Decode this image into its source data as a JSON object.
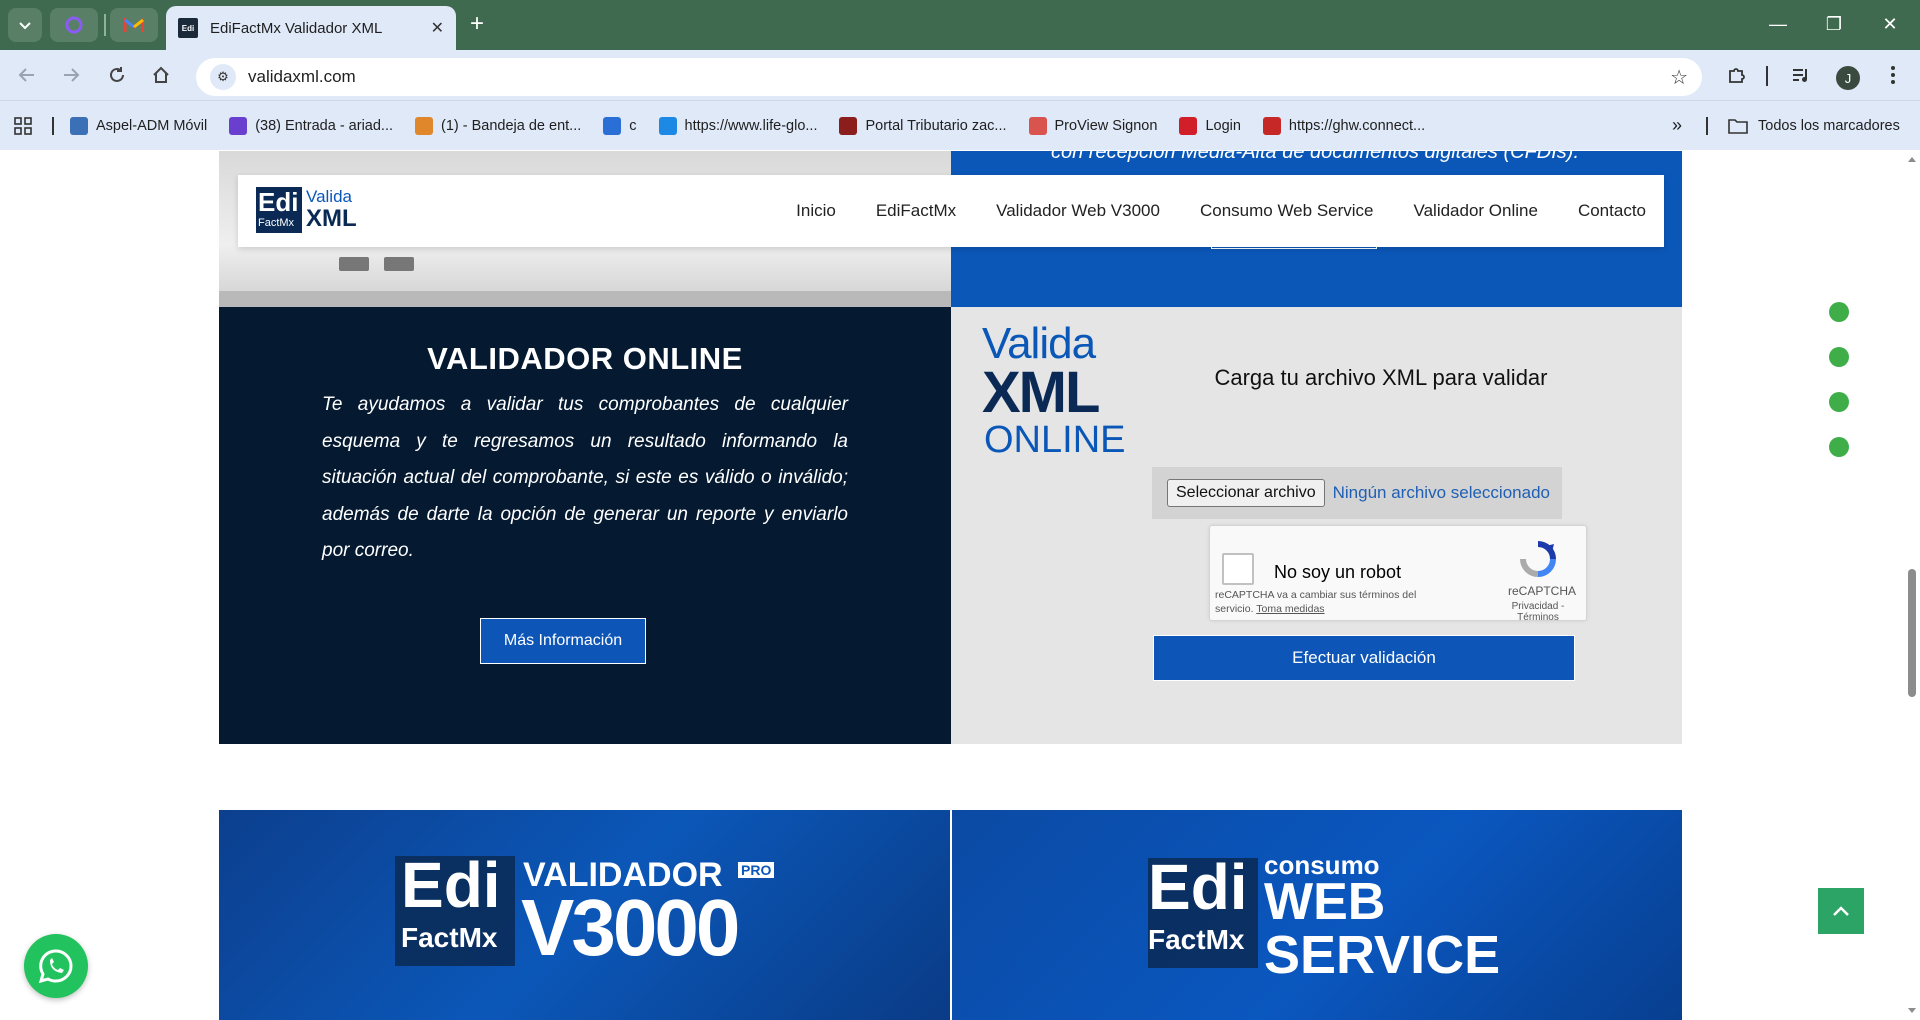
{
  "browser": {
    "pinned_tabs": [
      "tab-1",
      "tab-2",
      "tab-3"
    ],
    "active_tab": {
      "favicon_text": "EdiFactMx",
      "title": "EdiFactMx Validador XML",
      "close": "✕"
    },
    "new_tab": "+",
    "window_controls": {
      "minimize": "—",
      "restore": "❐",
      "close": "✕"
    },
    "url": "validaxml.com",
    "profile_initial": "J",
    "bookmarks": [
      {
        "label": "Aspel-ADM Móvil",
        "icon_color": "#3b6fb6"
      },
      {
        "label": "(38) Entrada - ariad...",
        "icon_color": "#6a3fd0"
      },
      {
        "label": "(1) - Bandeja de ent...",
        "icon_color": "#e0862b"
      },
      {
        "label": "c",
        "icon_color": "#2a6fd6"
      },
      {
        "label": "https://www.life-glo...",
        "icon_color": "#1e88e5"
      },
      {
        "label": "Portal Tributario zac...",
        "icon_color": "#8b1d1d"
      },
      {
        "label": "ProView Signon",
        "icon_color": "#d9534f"
      },
      {
        "label": "Login",
        "icon_color": "#d11f2a"
      },
      {
        "label": "https://ghw.connect...",
        "icon_color": "#c62828"
      }
    ],
    "bookmarks_more": "»",
    "all_bookmarks": "Todos los marcadores"
  },
  "hero": {
    "caption": "con recepción Media-Alta de documentos digitales (CFDIs)."
  },
  "site_nav": {
    "logo": {
      "edi": "Edi",
      "factmx": "FactMx",
      "valida": "Valida",
      "xml": "XML"
    },
    "items": [
      "Inicio",
      "EdiFactMx",
      "Validador Web V3000",
      "Consumo Web Service",
      "Validador Online",
      "Contacto"
    ]
  },
  "validator_online": {
    "title": "VALIDADOR ONLINE",
    "description": "Te ayudamos a validar tus comprobantes de cualquier esquema y te regresamos un resultado informando la situación actual del comprobante, si este es válido o inválido; además de darte la opción de generar un reporte y enviarlo por correo.",
    "more_button": "Más Información"
  },
  "upload": {
    "logo": {
      "valida": "Valida",
      "xml": "XML",
      "online": "ONLINE"
    },
    "title": "Carga tu archivo XML para validar",
    "file_button": "Seleccionar archivo",
    "file_status": "Ningún archivo seleccionado",
    "recaptcha": {
      "label": "No soy un robot",
      "notice": "reCAPTCHA va a cambiar sus términos del servicio.",
      "notice_link": "Toma medidas",
      "brand": "reCAPTCHA",
      "links": "Privacidad - Términos"
    },
    "submit_button": "Efectuar validación"
  },
  "promo_left": {
    "edi": "Edi",
    "factmx": "FactMx",
    "validador": "VALIDADOR",
    "pro": "PRO",
    "v3000": "V3000"
  },
  "promo_right": {
    "edi": "Edi",
    "factmx": "FactMx",
    "consumo": "consumo",
    "web": "WEB",
    "service": "SERVICE"
  },
  "colors": {
    "brand_blue": "#0b57b8",
    "dark_navy": "#051a31",
    "green_accent": "#3fae49"
  }
}
